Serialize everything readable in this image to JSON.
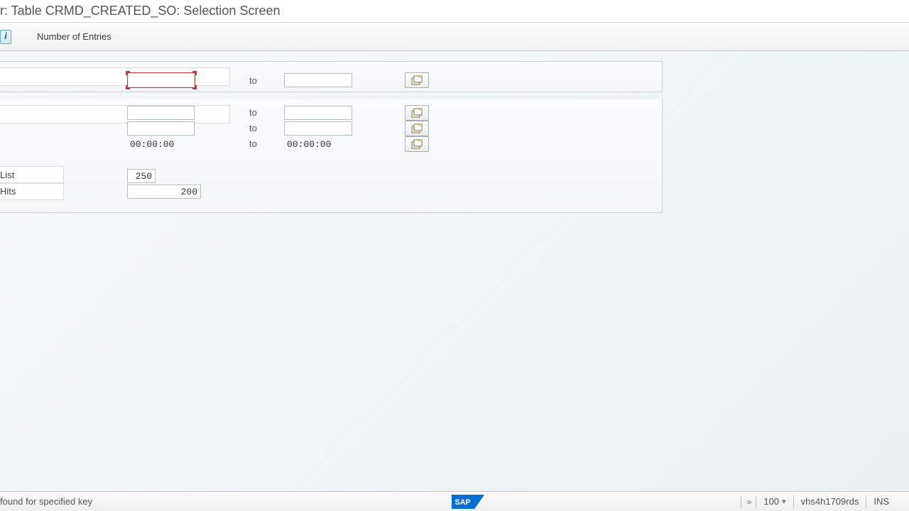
{
  "title": "r: Table CRMD_CREATED_SO: Selection Screen",
  "toolbar": {
    "info_icon_glyph": "i",
    "number_of_entries": "Number of Entries"
  },
  "labels": {
    "to": "to",
    "list": "List",
    "hits": "Hits"
  },
  "rows": {
    "row1": {
      "from": "",
      "to": ""
    },
    "row2": {
      "from": "",
      "to": ""
    },
    "row3": {
      "from": "",
      "to": ""
    },
    "row4": {
      "from": "00:00:00",
      "to": "00:00:00"
    }
  },
  "output": {
    "list": "250",
    "hits": "200"
  },
  "status": {
    "message": "found for specified key",
    "zoom": "100",
    "system": "vhs4h1709rds",
    "mode": "INS"
  }
}
